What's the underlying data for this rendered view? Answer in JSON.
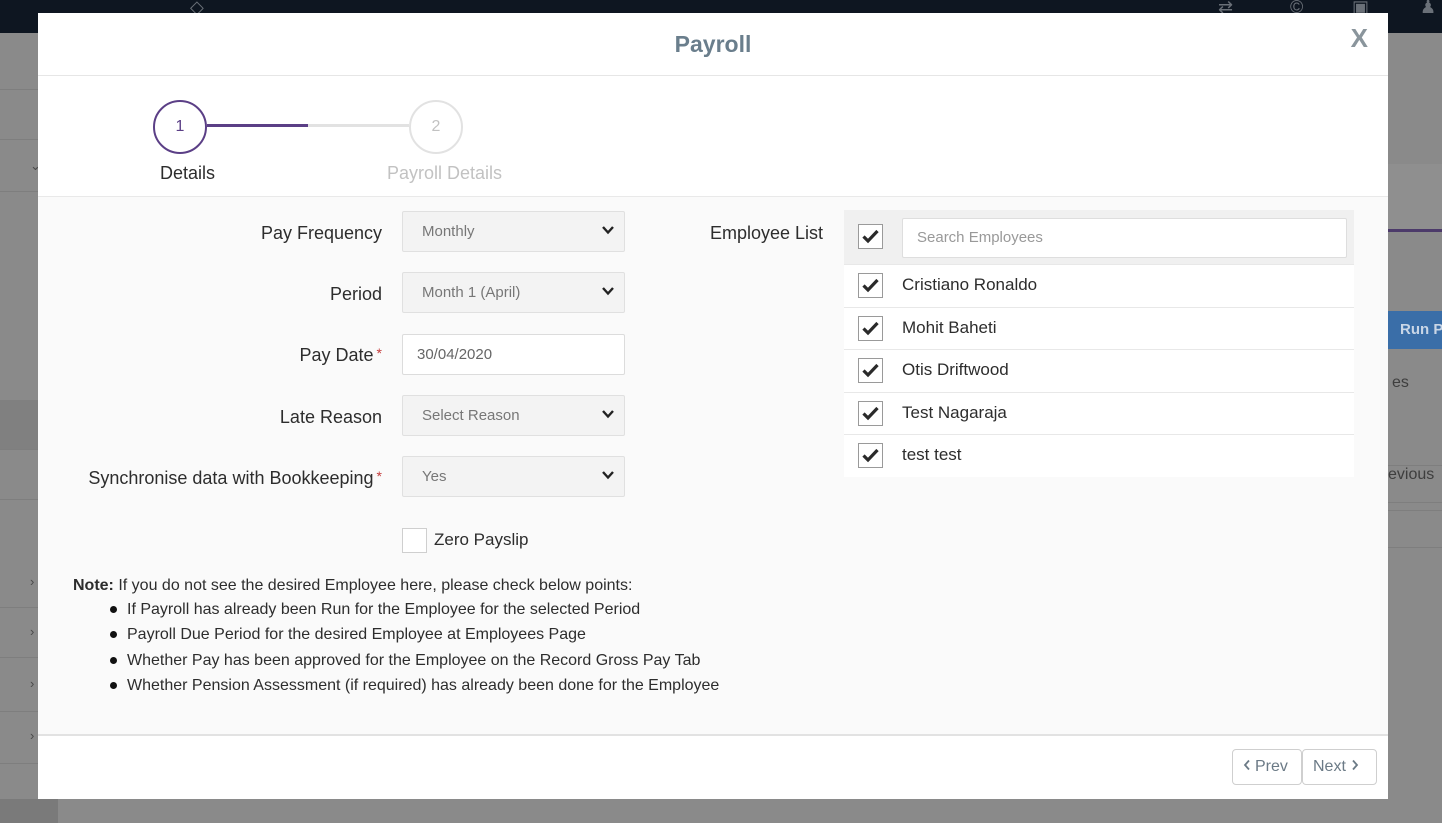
{
  "modal": {
    "title": "Payroll",
    "close_label": "X"
  },
  "wizard": {
    "steps": [
      {
        "number": "1",
        "label": "Details",
        "active": true
      },
      {
        "number": "2",
        "label": "Payroll Details",
        "active": false
      }
    ]
  },
  "form": {
    "pay_frequency": {
      "label": "Pay Frequency",
      "value": "Monthly"
    },
    "period": {
      "label": "Period",
      "value": "Month 1 (April)"
    },
    "pay_date": {
      "label": "Pay Date",
      "required": "*",
      "value": "30/04/2020"
    },
    "late_reason": {
      "label": "Late Reason",
      "placeholder": "Select Reason"
    },
    "sync_bookkeeping": {
      "label": "Synchronise data with Bookkeeping",
      "required": "*",
      "value": "Yes"
    },
    "zero_payslip": {
      "label": "Zero Payslip",
      "checked": false
    }
  },
  "note": {
    "heading": "Note:",
    "text": "If you do not see the desired Employee here, please check below points:",
    "points": [
      "If Payroll has already been Run for the Employee for the selected Period",
      "Payroll Due Period for the desired Employee at Employees Page",
      "Whether Pay has been approved for the Employee on the Record Gross Pay Tab",
      "Whether Pension Assessment (if required) has already been done for the Employee"
    ]
  },
  "employees": {
    "label": "Employee List",
    "search_placeholder": "Search Employees",
    "select_all_checked": true,
    "list": [
      {
        "name": "Cristiano Ronaldo",
        "checked": true
      },
      {
        "name": "Mohit Baheti",
        "checked": true
      },
      {
        "name": "Otis Driftwood",
        "checked": true
      },
      {
        "name": "Test Nagaraja",
        "checked": true
      },
      {
        "name": "test test",
        "checked": true
      }
    ]
  },
  "footer": {
    "prev_label": "Prev",
    "next_label": "Next"
  },
  "background": {
    "run_button_label": "Run P",
    "text_partial_1": "es",
    "text_partial_2": "evious"
  },
  "colors": {
    "accent": "#5b3f86",
    "title": "#6a7e8c",
    "required": "#c43b3b"
  }
}
